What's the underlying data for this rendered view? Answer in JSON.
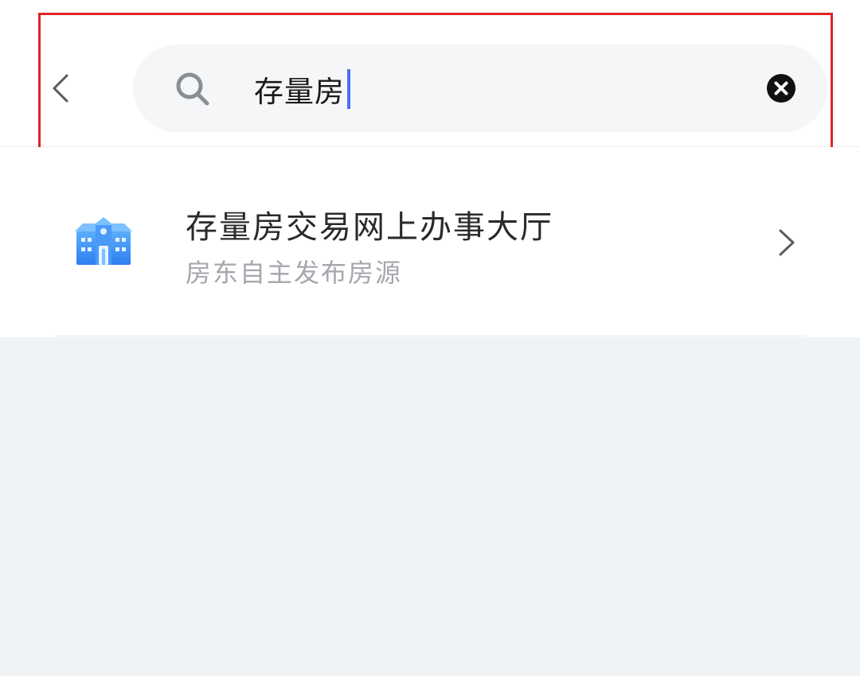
{
  "search": {
    "query": "存量房",
    "icons": {
      "back": "chevron-left-icon",
      "search": "search-icon",
      "clear": "close-circle-icon"
    }
  },
  "results": [
    {
      "title": "存量房交易网上办事大厅",
      "subtitle": "房东自主发布房源",
      "icon": "building-icon"
    }
  ],
  "colors": {
    "caret": "#4a6ff0",
    "highlight_border": "#e02424",
    "building_icon": "#3b8ff5",
    "empty_background": "#f0f3f6"
  }
}
